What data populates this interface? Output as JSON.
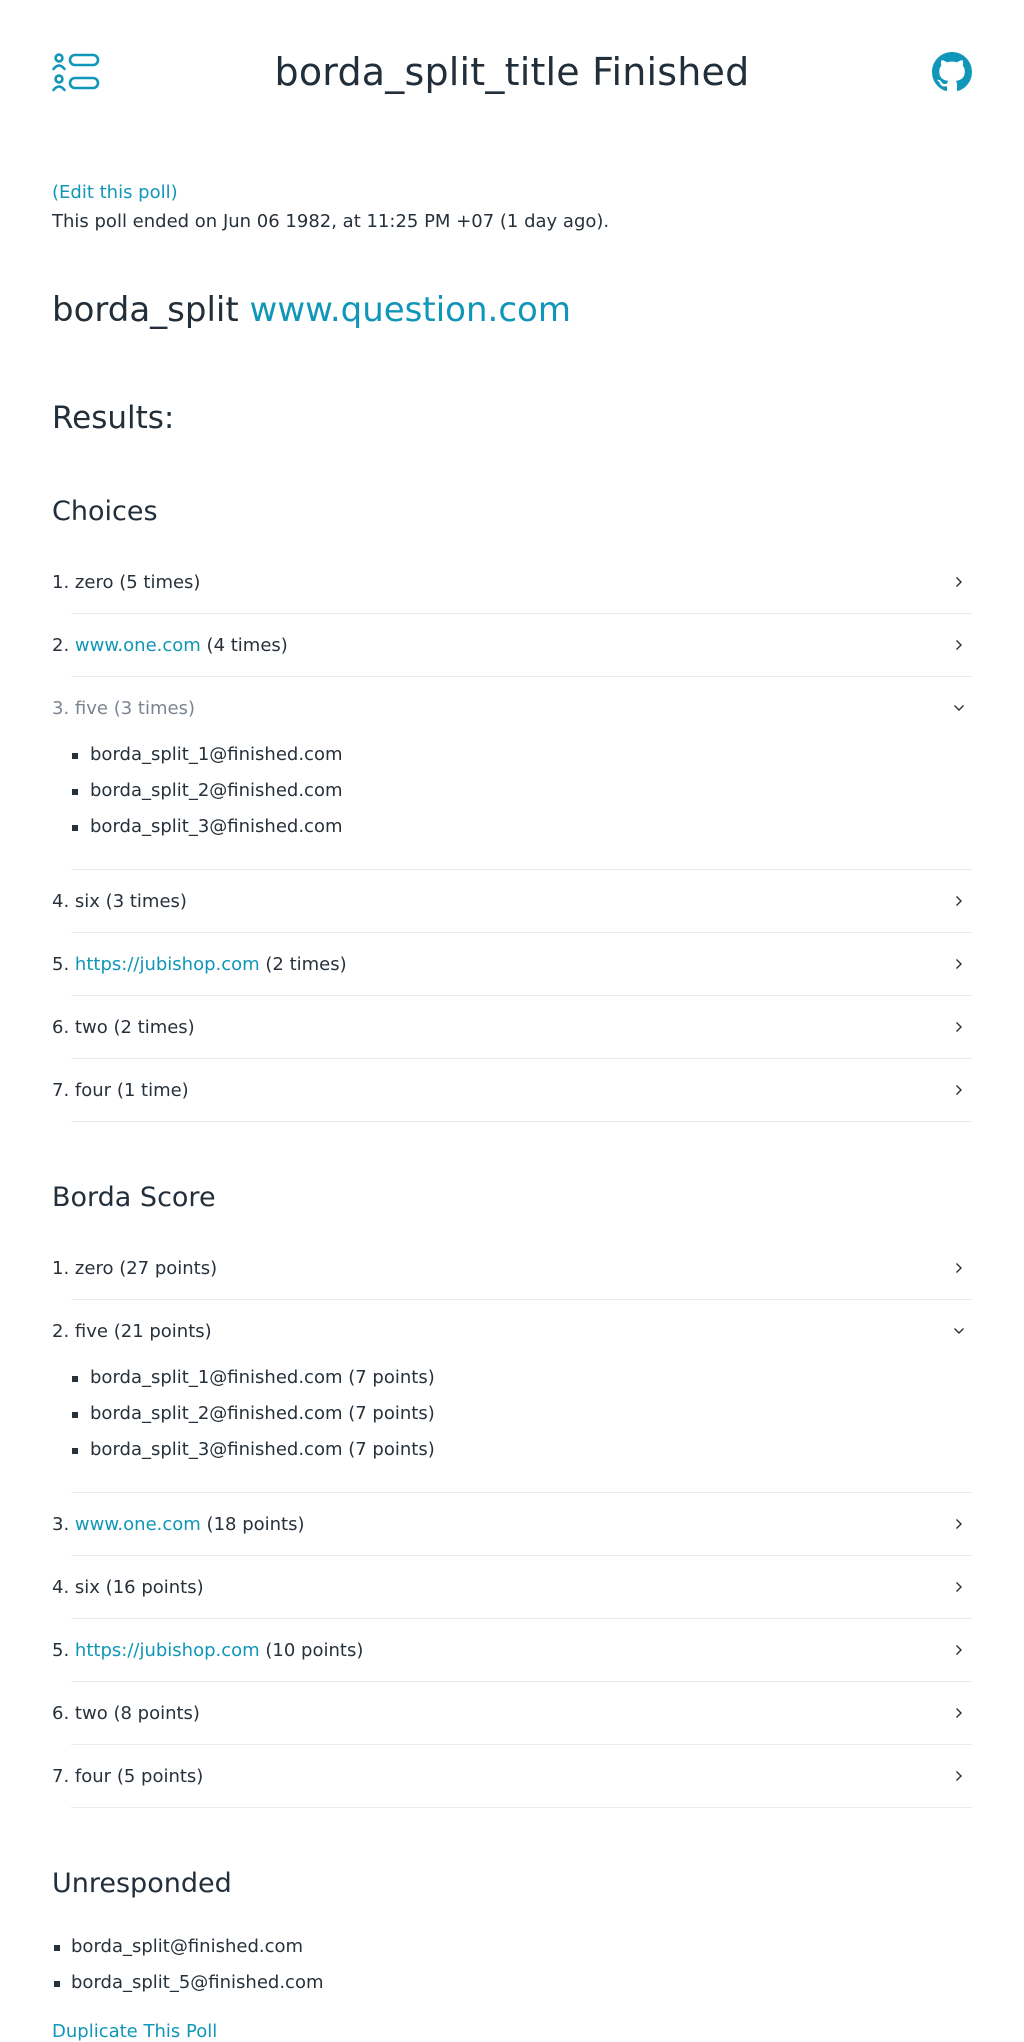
{
  "header": {
    "title": "borda_split_title Finished",
    "menu_icon": "users-list-icon",
    "github_icon": "github-icon"
  },
  "poll": {
    "edit_link": "(Edit this poll)",
    "ended_text": "This poll ended on Jun 06 1982, at 11:25 PM +07 (1 day ago).",
    "question_text": "borda_split",
    "question_link": "www.question.com",
    "results_heading": "Results:"
  },
  "choices": {
    "heading": "Choices",
    "items": [
      {
        "num": "1.",
        "link": "",
        "text": "zero",
        "suffix": " (5 times)",
        "open": false,
        "voters": []
      },
      {
        "num": "2.",
        "link": "www.one.com",
        "text": "",
        "suffix": " (4 times)",
        "open": false,
        "voters": []
      },
      {
        "num": "3.",
        "link": "",
        "text": "five",
        "suffix": " (3 times)",
        "open": true,
        "voters": [
          "borda_split_1@finished.com",
          "borda_split_2@finished.com",
          "borda_split_3@finished.com"
        ]
      },
      {
        "num": "4.",
        "link": "",
        "text": "six",
        "suffix": " (3 times)",
        "open": false,
        "voters": []
      },
      {
        "num": "5.",
        "link": "https://jubishop.com",
        "text": "",
        "suffix": " (2 times)",
        "open": false,
        "voters": []
      },
      {
        "num": "6.",
        "link": "",
        "text": "two",
        "suffix": " (2 times)",
        "open": false,
        "voters": []
      },
      {
        "num": "7.",
        "link": "",
        "text": "four",
        "suffix": " (1 time)",
        "open": false,
        "voters": []
      }
    ]
  },
  "borda": {
    "heading": "Borda Score",
    "items": [
      {
        "num": "1.",
        "link": "",
        "text": "zero",
        "suffix": " (27 points)",
        "open": false,
        "voters": []
      },
      {
        "num": "2.",
        "link": "",
        "text": "five",
        "suffix": " (21 points)",
        "open": true,
        "voters": [
          "borda_split_1@finished.com (7 points)",
          "borda_split_2@finished.com (7 points)",
          "borda_split_3@finished.com (7 points)"
        ]
      },
      {
        "num": "3.",
        "link": "www.one.com",
        "text": "",
        "suffix": " (18 points)",
        "open": false,
        "voters": []
      },
      {
        "num": "4.",
        "link": "",
        "text": "six",
        "suffix": " (16 points)",
        "open": false,
        "voters": []
      },
      {
        "num": "5.",
        "link": "https://jubishop.com",
        "text": "",
        "suffix": " (10 points)",
        "open": false,
        "voters": []
      },
      {
        "num": "6.",
        "link": "",
        "text": "two",
        "suffix": " (8 points)",
        "open": false,
        "voters": []
      },
      {
        "num": "7.",
        "link": "",
        "text": "four",
        "suffix": " (5 points)",
        "open": false,
        "voters": []
      }
    ]
  },
  "unresponded": {
    "heading": "Unresponded",
    "items": [
      "borda_split@finished.com",
      "borda_split_5@finished.com"
    ]
  },
  "footer": {
    "duplicate_link": "Duplicate This Poll"
  },
  "colors": {
    "accent": "#1096b8",
    "text": "#27313b",
    "muted": "#7a8490",
    "divider": "#e8ebee"
  }
}
